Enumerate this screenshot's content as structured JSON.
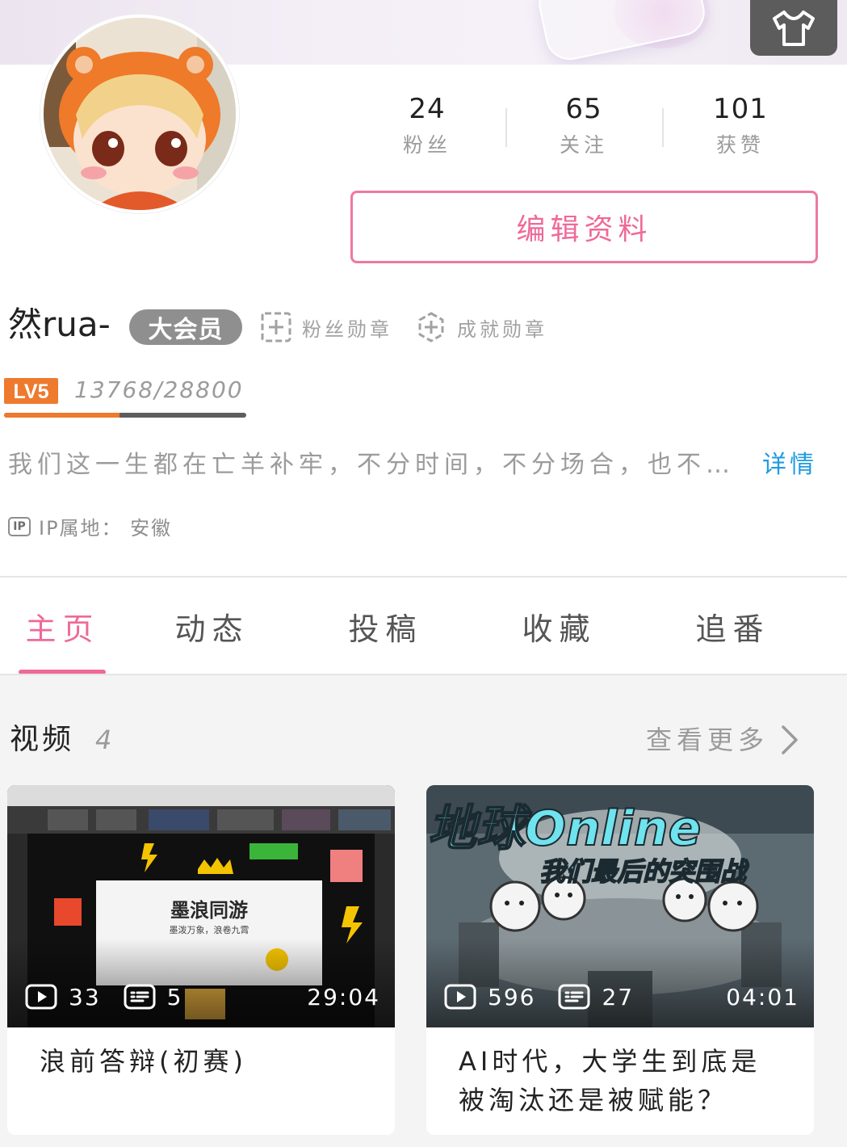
{
  "profile": {
    "username": "然rua-",
    "vip_label": "大会员",
    "fan_medal_label": "粉丝勋章",
    "achievement_medal_label": "成就勋章",
    "level_badge": "LV5",
    "exp_text": "13768/28800",
    "exp_progress": 0.478,
    "bio": "我们这一生都在亡羊补牢，不分时间，不分场合，也不…",
    "bio_more": "详情",
    "ip_icon": "IP",
    "ip_location": "IP属地：  安徽"
  },
  "stats": [
    {
      "value": "24",
      "label": "粉丝"
    },
    {
      "value": "65",
      "label": "关注"
    },
    {
      "value": "101",
      "label": "获赞"
    }
  ],
  "edit_button": "编辑资料",
  "tabs": [
    {
      "label": "主页",
      "active": true
    },
    {
      "label": "动态"
    },
    {
      "label": "投稿"
    },
    {
      "label": "收藏"
    },
    {
      "label": "追番"
    }
  ],
  "videos_section": {
    "title": "视频",
    "count": "4",
    "see_more": "查看更多"
  },
  "videos": [
    {
      "title": "浪前答辩(初赛)",
      "plays": "33",
      "danmaku": "5",
      "duration": "29:04",
      "thumb_title": "墨浪同游",
      "thumb_subtitle": "墨泼万象，浪卷九霄"
    },
    {
      "title": "AI时代，大学生到底是被淘汰还是被赋能？",
      "plays": "596",
      "danmaku": "27",
      "duration": "04:01",
      "thumb_title": "地球Online",
      "thumb_subtitle": "我们最后的突围战"
    }
  ],
  "colors": {
    "accent_pink": "#ee6a98",
    "link_blue": "#1f9be0",
    "level_orange": "#ee7a2e",
    "vip_gray": "#8f8f8f"
  }
}
